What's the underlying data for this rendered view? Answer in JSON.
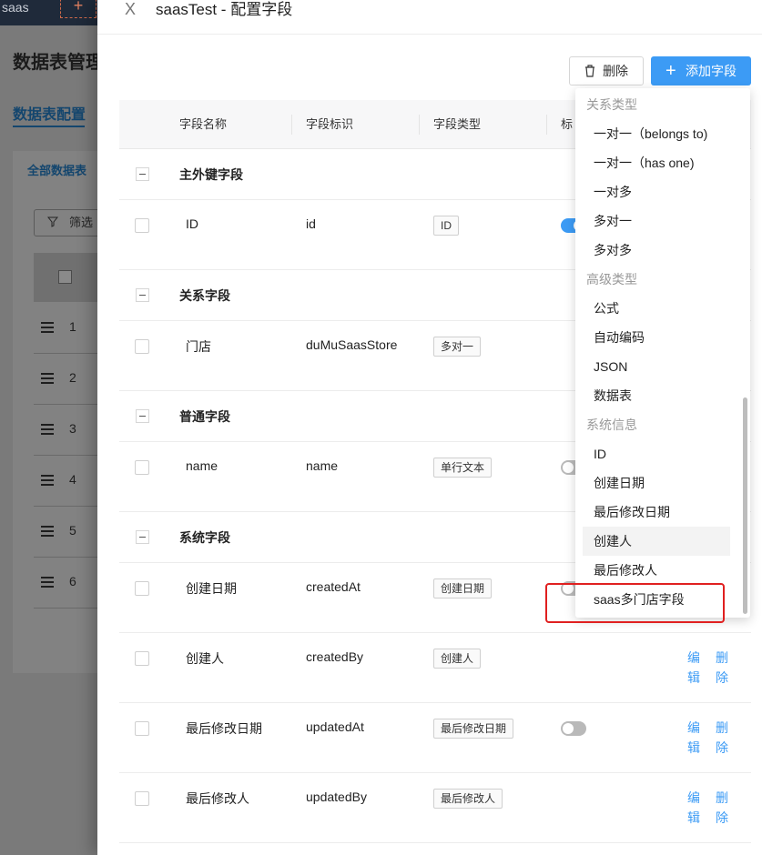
{
  "background": {
    "brand": "saas",
    "new_tab_symbol": "+",
    "page_title": "数据表管理",
    "tab_label": "数据表配置",
    "panel_title": "全部数据表",
    "filter_label": "筛选",
    "row_numbers": [
      "1",
      "2",
      "3",
      "4",
      "5",
      "6"
    ]
  },
  "drawer": {
    "close_symbol": "X",
    "title": "saasTest - 配置字段",
    "delete_label": "删除",
    "add_label": "添加字段",
    "add_symbol": "+",
    "columns": {
      "name": "字段名称",
      "id": "字段标识",
      "type": "字段类型",
      "label": "标"
    },
    "groups": [
      {
        "label": "主外键字段",
        "rows": [
          {
            "name": "ID",
            "id": "id",
            "type": "ID",
            "toggle": "on",
            "actions": false
          }
        ]
      },
      {
        "label": "关系字段",
        "rows": [
          {
            "name": "门店",
            "id": "duMuSaasStore",
            "type": "多对一",
            "toggle": "none",
            "actions": false
          }
        ]
      },
      {
        "label": "普通字段",
        "rows": [
          {
            "name": "name",
            "id": "name",
            "type": "单行文本",
            "toggle": "off",
            "actions": false
          }
        ]
      },
      {
        "label": "系统字段",
        "rows": [
          {
            "name": "创建日期",
            "id": "createdAt",
            "type": "创建日期",
            "toggle": "off",
            "actions": false
          },
          {
            "name": "创建人",
            "id": "createdBy",
            "type": "创建人",
            "toggle": "none",
            "actions": true
          },
          {
            "name": "最后修改日期",
            "id": "updatedAt",
            "type": "最后修改日期",
            "toggle": "off",
            "actions": true
          },
          {
            "name": "最后修改人",
            "id": "updatedBy",
            "type": "最后修改人",
            "toggle": "none",
            "actions": true
          }
        ]
      }
    ],
    "edit_label": "编辑",
    "delete_row_label": "删除"
  },
  "dropdown": {
    "groups": [
      {
        "label": "关系类型",
        "items": [
          "一对一（belongs to)",
          "一对一（has one)",
          "一对多",
          "多对一",
          "多对多"
        ]
      },
      {
        "label": "高级类型",
        "items": [
          "公式",
          "自动编码",
          "JSON",
          "数据表"
        ]
      },
      {
        "label": "系统信息",
        "items": [
          "ID",
          "创建日期",
          "最后修改日期",
          "创建人",
          "最后修改人",
          "saas多门店字段"
        ]
      }
    ],
    "hovered_item": "创建人",
    "highlighted_item": "saas多门店字段"
  }
}
